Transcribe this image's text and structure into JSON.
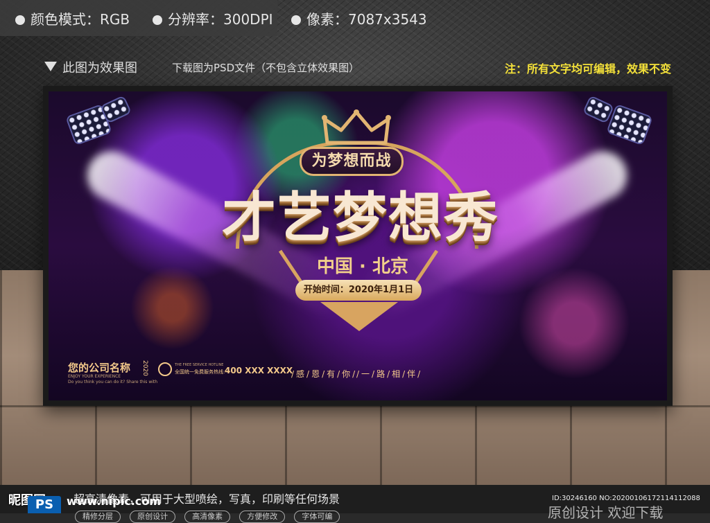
{
  "info": {
    "color_mode": "颜色模式：RGB",
    "resolution": "分辨率：300DPI",
    "pixels": "像素：7087x3543"
  },
  "subtitle": {
    "effect": "此图为效果图",
    "download": "下载图为PSD文件（不包含立体效果图）",
    "note": "注：所有文字均可编辑，效果不变"
  },
  "poster": {
    "banner": "为梦想而战",
    "title": "才艺梦想秀",
    "location": "中国 · 北京",
    "start_time": "开始时间：2020年1月1日",
    "company": "您的公司名称",
    "company_year": "2020",
    "company_en": "ENJOY YOUR EXPERIENCE",
    "company_small": "Do you think you can do it? Share this with your friends and join the show tonight",
    "hotline_en": "THE FREE SERVICE HOTLINE",
    "hotline_cn": "全国统一免费服务热线:",
    "hotline_number": "400 XXX XXXX",
    "slogan_part1": "/感/恩/有/你/",
    "slogan_part2": "/一/路/相/伴/"
  },
  "footer": {
    "site_logo": "昵图网",
    "site_url": "www.nipic.com",
    "hd_text": "超高清像素，可用于大型喷绘，写真，印刷等任何场景",
    "chips": [
      "精修分层",
      "原创设计",
      "高清像素",
      "方便修改",
      "字体可编"
    ],
    "image_id": "ID:30246160 NO:20200106172114112088",
    "watermark": "原创设计  欢迎下载",
    "ps_label": "PS"
  },
  "colors": {
    "gold": "#d8a460",
    "note_yellow": "#f4e13a",
    "poster_purple": "#2a0c3f"
  }
}
